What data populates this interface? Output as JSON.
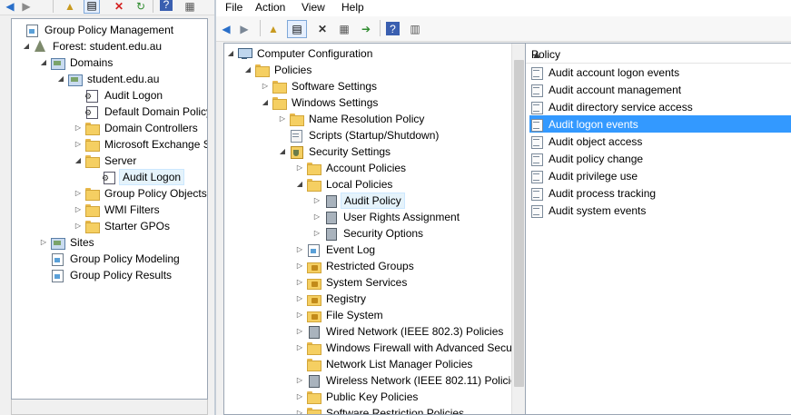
{
  "gpm": {
    "tree": [
      {
        "label": "Group Policy Management",
        "expander": "",
        "icon": "gpm-console-icon",
        "level": 0
      },
      {
        "label": "Forest: student.edu.au",
        "expander": "collapse",
        "icon": "forest-icon",
        "level": 1
      },
      {
        "label": "Domains",
        "expander": "collapse",
        "icon": "domains-folder-icon",
        "level": 2
      },
      {
        "label": "student.edu.au",
        "expander": "collapse",
        "icon": "domain-icon",
        "level": 3
      },
      {
        "label": "Audit Logon",
        "expander": "",
        "icon": "gpo-link-icon",
        "level": 4
      },
      {
        "label": "Default Domain Policy",
        "expander": "",
        "icon": "gpo-link-icon",
        "level": 4
      },
      {
        "label": "Domain Controllers",
        "expander": "expand",
        "icon": "ou-folder-icon",
        "level": 4
      },
      {
        "label": "Microsoft Exchange S",
        "expander": "expand",
        "icon": "ou-folder-icon",
        "level": 4
      },
      {
        "label": "Server",
        "expander": "collapse",
        "icon": "ou-folder-icon",
        "level": 4
      },
      {
        "label": "Audit Logon",
        "expander": "",
        "icon": "gpo-link-icon",
        "level": 5,
        "selected": true
      },
      {
        "label": "Group Policy Objects",
        "expander": "expand",
        "icon": "gpo-folder-icon",
        "level": 4
      },
      {
        "label": "WMI Filters",
        "expander": "expand",
        "icon": "wmi-folder-icon",
        "level": 4
      },
      {
        "label": "Starter GPOs",
        "expander": "expand",
        "icon": "starter-folder-icon",
        "level": 4
      },
      {
        "label": "Sites",
        "expander": "expand",
        "icon": "sites-icon",
        "level": 2
      },
      {
        "label": "Group Policy Modeling",
        "expander": "",
        "icon": "modeling-icon",
        "level": 2
      },
      {
        "label": "Group Policy Results",
        "expander": "",
        "icon": "results-icon",
        "level": 2
      }
    ]
  },
  "gpe": {
    "menu": [
      "File",
      "Action",
      "View",
      "Help"
    ],
    "tree": [
      {
        "label": "Computer Configuration",
        "expander": "collapse",
        "icon": "computer-icon",
        "level": 0
      },
      {
        "label": "Policies",
        "expander": "collapse",
        "icon": "folder-icon",
        "level": 1
      },
      {
        "label": "Software Settings",
        "expander": "expand",
        "icon": "folder-icon",
        "level": 2
      },
      {
        "label": "Windows Settings",
        "expander": "collapse",
        "icon": "folder-icon",
        "level": 2
      },
      {
        "label": "Name Resolution Policy",
        "expander": "expand",
        "icon": "folder-icon",
        "level": 3
      },
      {
        "label": "Scripts (Startup/Shutdown)",
        "expander": "",
        "icon": "script-icon",
        "level": 3
      },
      {
        "label": "Security Settings",
        "expander": "collapse",
        "icon": "shield-icon",
        "level": 3
      },
      {
        "label": "Account Policies",
        "expander": "expand",
        "icon": "folder-icon",
        "level": 4
      },
      {
        "label": "Local Policies",
        "expander": "collapse",
        "icon": "folder-icon",
        "level": 4
      },
      {
        "label": "Audit Policy",
        "expander": "expand",
        "icon": "audit-folder-icon",
        "level": 5,
        "selected": true
      },
      {
        "label": "User Rights Assignment",
        "expander": "expand",
        "icon": "audit-folder-icon",
        "level": 5
      },
      {
        "label": "Security Options",
        "expander": "expand",
        "icon": "audit-folder-icon",
        "level": 5
      },
      {
        "label": "Event Log",
        "expander": "expand",
        "icon": "report-icon",
        "level": 4
      },
      {
        "label": "Restricted Groups",
        "expander": "expand",
        "icon": "lock-folder-icon",
        "level": 4
      },
      {
        "label": "System Services",
        "expander": "expand",
        "icon": "lock-folder-icon",
        "level": 4
      },
      {
        "label": "Registry",
        "expander": "expand",
        "icon": "lock-folder-icon",
        "level": 4
      },
      {
        "label": "File System",
        "expander": "expand",
        "icon": "lock-folder-icon",
        "level": 4
      },
      {
        "label": "Wired Network (IEEE 802.3) Policies",
        "expander": "expand",
        "icon": "network-icon",
        "level": 4
      },
      {
        "label": "Windows Firewall with Advanced Secu",
        "expander": "expand",
        "icon": "folder-icon",
        "level": 4
      },
      {
        "label": "Network List Manager Policies",
        "expander": "",
        "icon": "folder-icon",
        "level": 4
      },
      {
        "label": "Wireless Network (IEEE 802.11) Policie",
        "expander": "expand",
        "icon": "network-icon",
        "level": 4
      },
      {
        "label": "Public Key Policies",
        "expander": "expand",
        "icon": "folder-icon",
        "level": 4
      },
      {
        "label": "Software Restriction Policies",
        "expander": "expand",
        "icon": "folder-icon",
        "level": 4
      }
    ],
    "list": {
      "column": "Policy",
      "items": [
        {
          "label": "Audit account logon events"
        },
        {
          "label": "Audit account management"
        },
        {
          "label": "Audit directory service access"
        },
        {
          "label": "Audit logon events",
          "selected": true
        },
        {
          "label": "Audit object access"
        },
        {
          "label": "Audit policy change"
        },
        {
          "label": "Audit privilege use"
        },
        {
          "label": "Audit process tracking"
        },
        {
          "label": "Audit system events"
        }
      ]
    }
  },
  "colors": {
    "selection": "#3399ff",
    "tree_selection": "#e5f3fb",
    "folder": "#f5cf62"
  }
}
